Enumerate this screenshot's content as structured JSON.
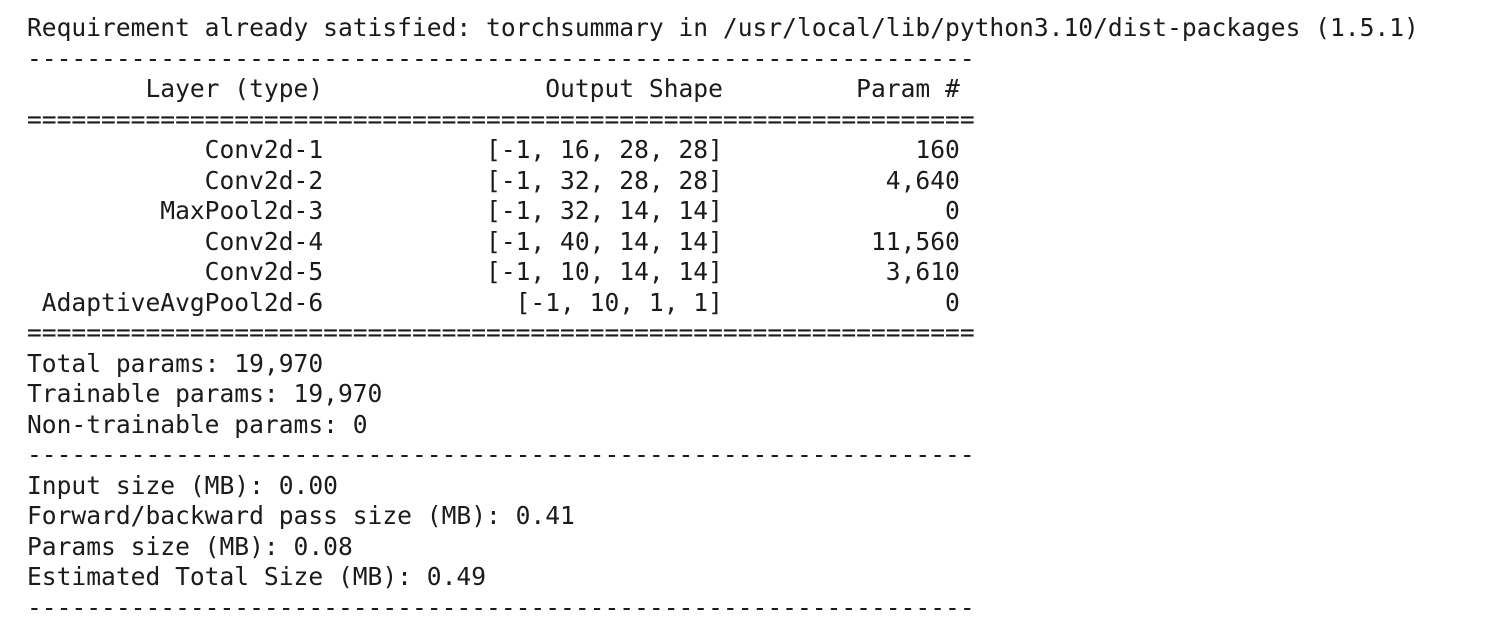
{
  "output": {
    "requirement_line": "Requirement already satisfied: torchsummary in /usr/local/lib/python3.10/dist-packages (1.5.1)",
    "rule_dash": "----------------------------------------------------------------",
    "rule_equals": "================================================================",
    "header_line": "        Layer (type)               Output Shape         Param #",
    "layers": [
      {
        "line": "            Conv2d-1           [-1, 16, 28, 28]             160"
      },
      {
        "line": "            Conv2d-2           [-1, 32, 28, 28]           4,640"
      },
      {
        "line": "         MaxPool2d-3           [-1, 32, 14, 14]               0"
      },
      {
        "line": "            Conv2d-4           [-1, 40, 14, 14]          11,560"
      },
      {
        "line": "            Conv2d-5           [-1, 10, 14, 14]           3,610"
      },
      {
        "line": " AdaptiveAvgPool2d-6             [-1, 10, 1, 1]               0"
      }
    ],
    "total_params": "Total params: 19,970",
    "trainable_params": "Trainable params: 19,970",
    "non_trainable_params": "Non-trainable params: 0",
    "input_size": "Input size (MB): 0.00",
    "forward_backward_size": "Forward/backward pass size (MB): 0.41",
    "params_size": "Params size (MB): 0.08",
    "estimated_total_size": "Estimated Total Size (MB): 0.49"
  }
}
